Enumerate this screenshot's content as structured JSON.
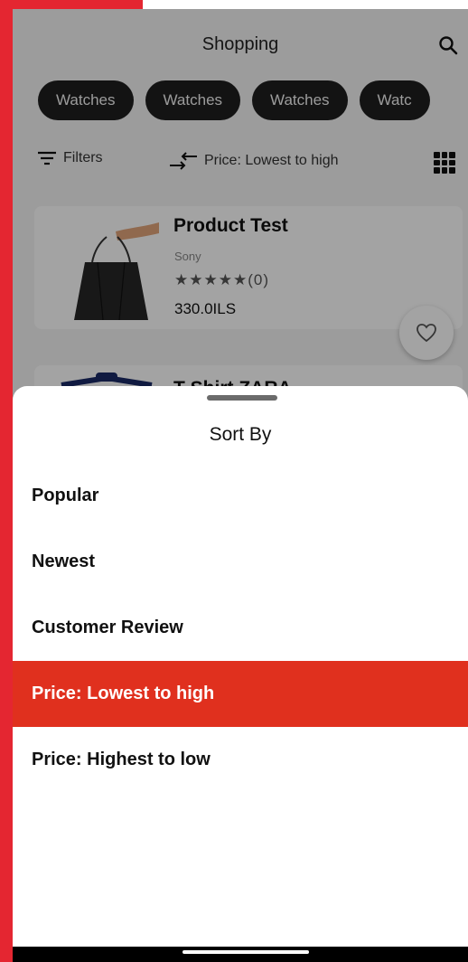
{
  "app": {
    "title": "Shopping",
    "chips": [
      "Watches",
      "Watches",
      "Watches",
      "Watc"
    ]
  },
  "toolbar": {
    "filters_label": "Filters",
    "sort_label": "Price: Lowest to high"
  },
  "products": [
    {
      "name": "Product Test",
      "brand": "Sony",
      "stars": "★★★★★",
      "reviews": "(0)",
      "price": "330.0ILS"
    },
    {
      "name": "T-Shirt ZARA"
    }
  ],
  "sheet": {
    "title": "Sort By",
    "options": [
      {
        "label": "Popular"
      },
      {
        "label": "Newest"
      },
      {
        "label": "Customer Review"
      },
      {
        "label": "Price: Lowest to high",
        "selected": true
      },
      {
        "label": "Price: Highest to low"
      }
    ]
  },
  "colors": {
    "accent": "#e0301e",
    "backdrop": "#e42631"
  },
  "icons": [
    "search-icon",
    "filter-icon",
    "sort-icon",
    "grid-icon",
    "heart-icon"
  ]
}
